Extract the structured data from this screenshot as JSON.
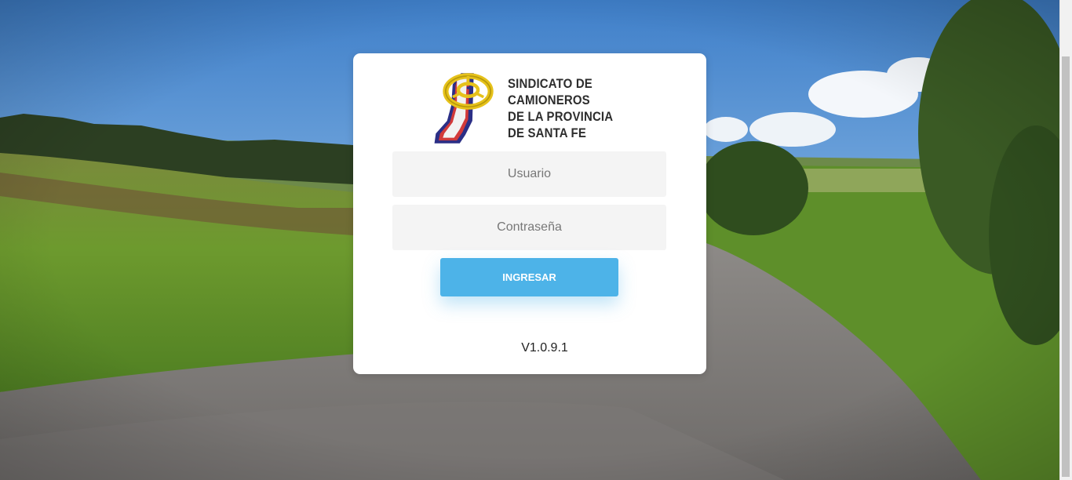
{
  "login": {
    "logo_lines": [
      "SINDICATO DE",
      "CAMIONEROS",
      "DE LA PROVINCIA",
      "DE SANTA FE"
    ],
    "username_placeholder": "Usuario",
    "password_placeholder": "Contraseña",
    "submit_label": "INGRESAR",
    "version": "V1.0.9.1"
  },
  "colors": {
    "button": "#4db3e8",
    "field_bg": "#f4f4f4",
    "card_bg": "#ffffff"
  },
  "icons": {
    "logo": "santa-fe-province-steering-wheel-logo"
  }
}
